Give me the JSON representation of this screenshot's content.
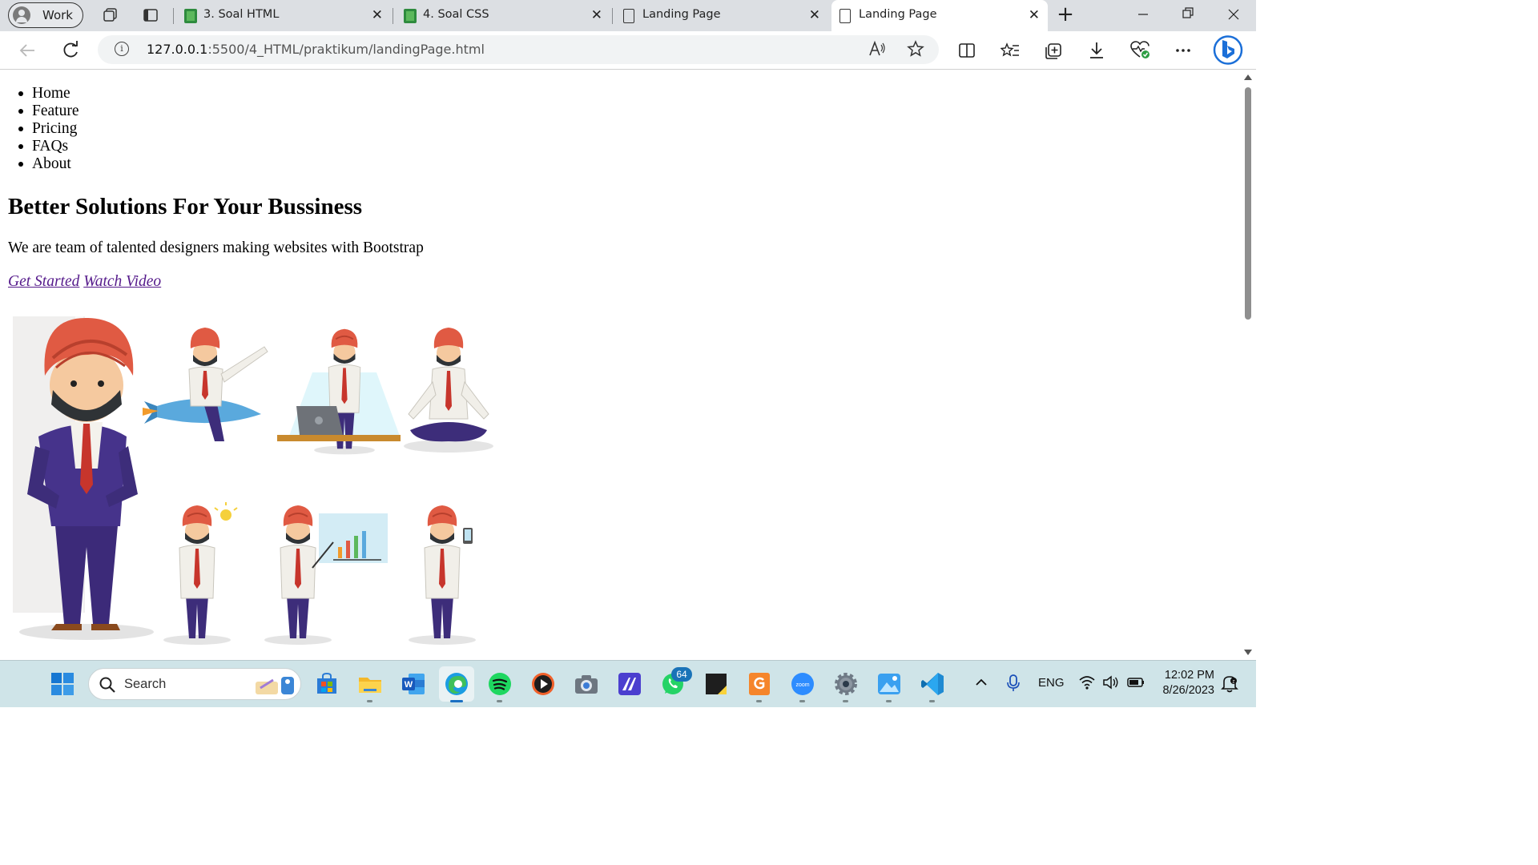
{
  "browser": {
    "profile_label": "Work",
    "tabs": [
      {
        "title": "3. Soal HTML",
        "icon": "spreadsheet-icon",
        "active": false
      },
      {
        "title": "4. Soal CSS",
        "icon": "spreadsheet-icon",
        "active": false
      },
      {
        "title": "Landing Page",
        "icon": "page-icon",
        "active": false
      },
      {
        "title": "Landing Page",
        "icon": "page-icon",
        "active": true
      }
    ],
    "tab_close_glyph": "✕",
    "new_tab_glyph": "+",
    "address": {
      "host": "127.0.0.1",
      "path": ":5500/4_HTML/praktikum/landingPage.html"
    }
  },
  "page": {
    "nav_items": [
      "Home",
      "Feature",
      "Pricing",
      "FAQs",
      "About"
    ],
    "heading": "Better Solutions For Your Bussiness",
    "tagline": "We are team of talented designers making websites with Bootstrap",
    "links": {
      "get_started": "Get Started",
      "watch_video": "Watch Video"
    },
    "illustration": "hero-illustration"
  },
  "taskbar": {
    "search_placeholder": "Search",
    "whatsapp_badge": "64",
    "language": "ENG",
    "time": "12:02 PM",
    "date": "8/26/2023"
  },
  "colors": {
    "link_visited": "#551a8b",
    "taskbar_bg": "#cfe4e8",
    "tabstrip_bg": "#dcdfe3"
  }
}
